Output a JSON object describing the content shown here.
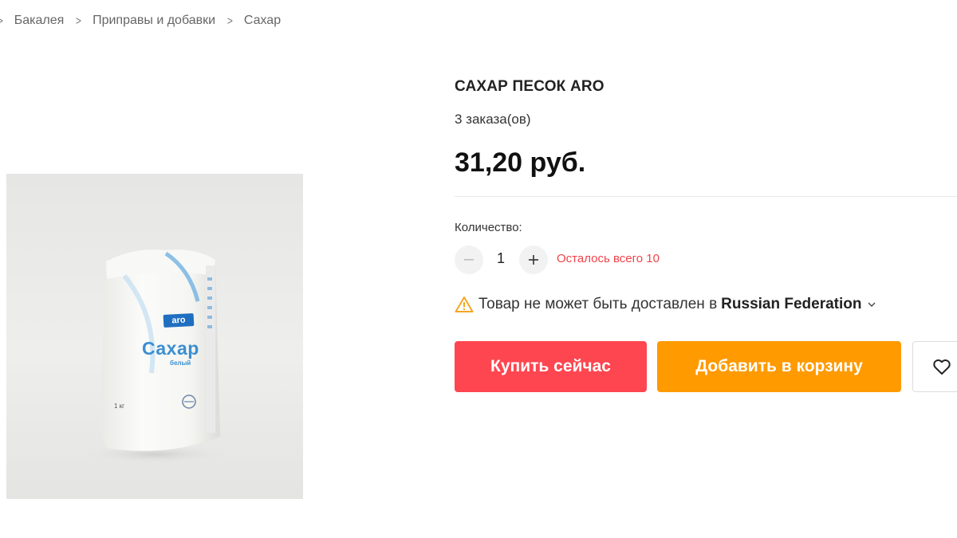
{
  "breadcrumb": {
    "items": [
      "Бакалея",
      "Приправы и добавки",
      "Сахар"
    ]
  },
  "product": {
    "title": "САХАР ПЕСОК ARO",
    "orders": "3 заказа(ов)",
    "price": "31,20 руб.",
    "image": {
      "brand": "aro",
      "name": "Сахар",
      "sub": "белый",
      "weight": "1 кг"
    }
  },
  "quantity": {
    "label": "Количество:",
    "value": "1",
    "stock_text": "Осталось всего 10"
  },
  "delivery": {
    "text": "Товар не может быть доставлен в",
    "country": "Russian Federation"
  },
  "actions": {
    "buy_label": "Купить сейчас",
    "cart_label": "Добавить в корзину"
  },
  "colors": {
    "buy": "#fe4650",
    "cart": "#ff9a00",
    "stock": "#f0434b",
    "warning": "#f5a623"
  },
  "icons": [
    "chevron-right-icon",
    "minus-icon",
    "plus-icon",
    "warning-icon",
    "chevron-down-icon",
    "heart-icon"
  ]
}
